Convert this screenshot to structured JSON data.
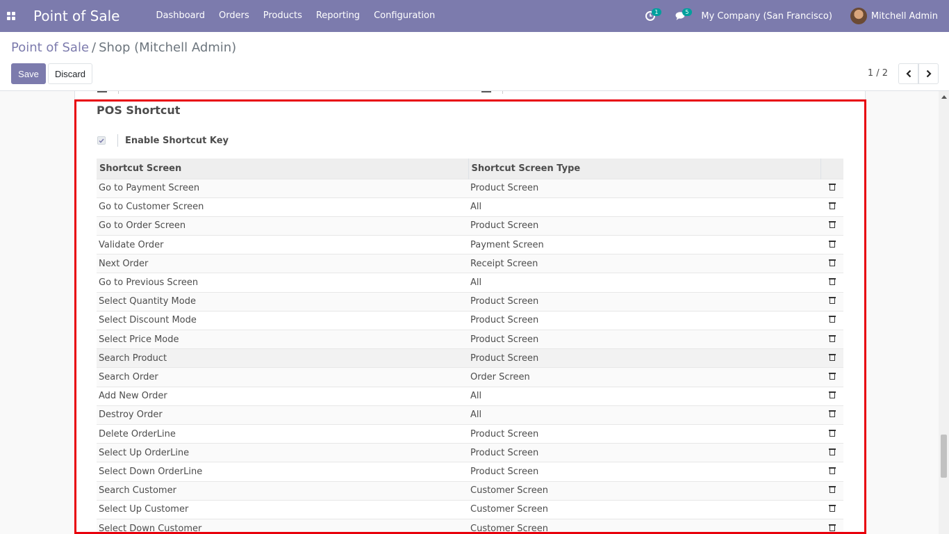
{
  "navbar": {
    "brand": "Point of Sale",
    "menu": [
      "Dashboard",
      "Orders",
      "Products",
      "Reporting",
      "Configuration"
    ],
    "activity_count": "1",
    "message_count": "5",
    "company": "My Company (San Francisco)",
    "user": "Mitchell Admin"
  },
  "breadcrumb": {
    "parent": "Point of Sale",
    "separator": "/",
    "current": "Shop (Mitchell Admin)"
  },
  "buttons": {
    "save": "Save",
    "discard": "Discard"
  },
  "pager": {
    "value": "1 / 2"
  },
  "section": {
    "title": "POS Shortcut",
    "enable_label": "Enable Shortcut Key",
    "enable_checked": true
  },
  "table": {
    "headers": [
      "Shortcut Screen",
      "Shortcut Screen Type"
    ],
    "rows": [
      [
        "Go to Payment Screen",
        "Product Screen"
      ],
      [
        "Go to Customer Screen",
        "All"
      ],
      [
        "Go to Order Screen",
        "Product Screen"
      ],
      [
        "Validate Order",
        "Payment Screen"
      ],
      [
        "Next Order",
        "Receipt Screen"
      ],
      [
        "Go to Previous Screen",
        "All"
      ],
      [
        "Select Quantity Mode",
        "Product Screen"
      ],
      [
        "Select Discount Mode",
        "Product Screen"
      ],
      [
        "Select Price Mode",
        "Product Screen"
      ],
      [
        "Search Product",
        "Product Screen"
      ],
      [
        "Search Order",
        "Order Screen"
      ],
      [
        "Add New Order",
        "All"
      ],
      [
        "Destroy Order",
        "All"
      ],
      [
        "Delete OrderLine",
        "Product Screen"
      ],
      [
        "Select Up OrderLine",
        "Product Screen"
      ],
      [
        "Select Down OrderLine",
        "Product Screen"
      ],
      [
        "Search Customer",
        "Customer Screen"
      ],
      [
        "Select Up Customer",
        "Customer Screen"
      ],
      [
        "Select Down Customer",
        "Customer Screen"
      ]
    ]
  },
  "colors": {
    "primary": "#7c7bad",
    "highlight_border": "#e8000b",
    "badge": "#00a09d"
  }
}
